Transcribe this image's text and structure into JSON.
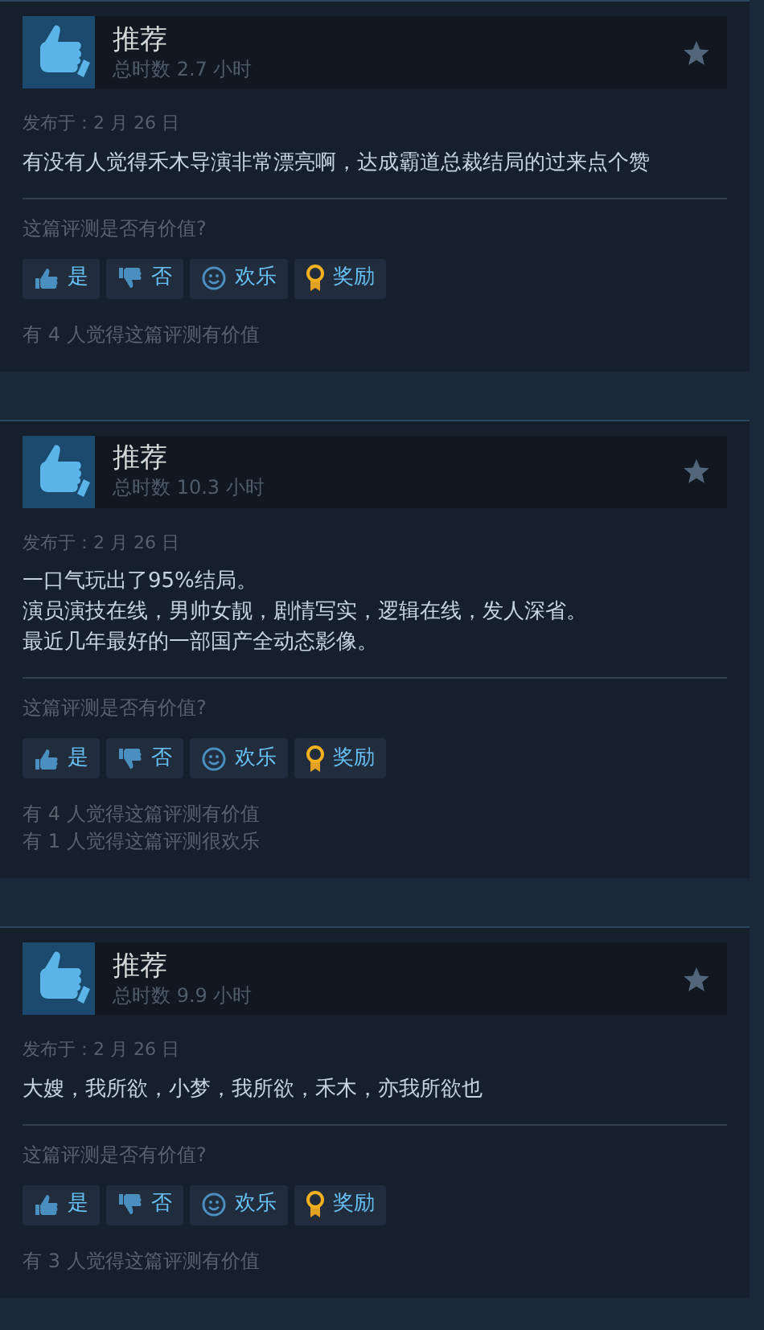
{
  "reviews": [
    {
      "verdict": "推荐",
      "playtime": "总时数 2.7 小时",
      "posted": "发布于：2 月 26 日",
      "body": [
        "有没有人觉得禾木导演非常漂亮啊，达成霸道总裁结局的过来点个赞"
      ],
      "question": "这篇评测是否有价值?",
      "buttons": [
        {
          "kind": "yes",
          "label": "是"
        },
        {
          "kind": "no",
          "label": "否"
        },
        {
          "kind": "funny",
          "label": "欢乐"
        },
        {
          "kind": "award",
          "label": "奖励"
        }
      ],
      "stats": [
        "有 4 人觉得这篇评测有价值"
      ]
    },
    {
      "verdict": "推荐",
      "playtime": "总时数 10.3 小时",
      "posted": "发布于：2 月 26 日",
      "body": [
        "一口气玩出了95%结局。",
        "演员演技在线，男帅女靓，剧情写实，逻辑在线，发人深省。",
        "最近几年最好的一部国产全动态影像。"
      ],
      "question": "这篇评测是否有价值?",
      "buttons": [
        {
          "kind": "yes",
          "label": "是"
        },
        {
          "kind": "no",
          "label": "否"
        },
        {
          "kind": "funny",
          "label": "欢乐"
        },
        {
          "kind": "award",
          "label": "奖励"
        }
      ],
      "stats": [
        "有 4 人觉得这篇评测有价值",
        "有 1 人觉得这篇评测很欢乐"
      ]
    },
    {
      "verdict": "推荐",
      "playtime": "总时数 9.9 小时",
      "posted": "发布于：2 月 26 日",
      "body": [
        "大嫂，我所欲，小梦，我所欲，禾木，亦我所欲也"
      ],
      "question": "这篇评测是否有价值?",
      "buttons": [
        {
          "kind": "yes",
          "label": "是"
        },
        {
          "kind": "no",
          "label": "否"
        },
        {
          "kind": "funny",
          "label": "欢乐"
        },
        {
          "kind": "award",
          "label": "奖励"
        }
      ],
      "stats": [
        "有 3 人觉得这篇评测有价值"
      ]
    }
  ]
}
